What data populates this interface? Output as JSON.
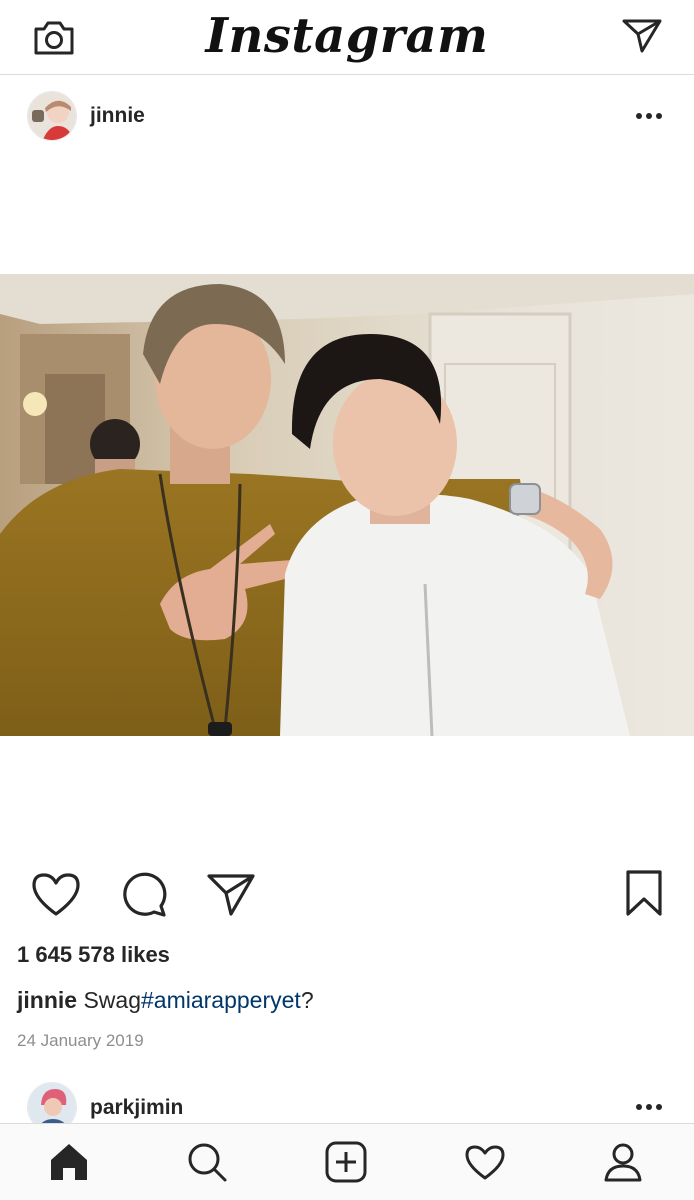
{
  "app": {
    "name": "Instagram"
  },
  "post": {
    "username": "jinnie",
    "likes_text": "1 645 578 likes",
    "caption": {
      "username": "jinnie",
      "text": "Swag",
      "hashtag": "#amiarapperyet",
      "suffix": "?"
    },
    "date": "24 January 2019"
  },
  "next_post": {
    "username": "parkjimin"
  },
  "icons": {
    "header_left": "camera-icon",
    "header_right": "direct-send-icon",
    "more": "more-options-icon",
    "like": "heart-icon",
    "comment": "comment-icon",
    "share": "share-icon",
    "save": "bookmark-icon",
    "nav": [
      "home-icon",
      "search-icon",
      "add-post-icon",
      "activity-heart-icon",
      "profile-icon"
    ]
  },
  "colors": {
    "hashtag": "#00376b",
    "date": "#8e8e8e",
    "text": "#262626",
    "divider": "#dbdbdb"
  }
}
